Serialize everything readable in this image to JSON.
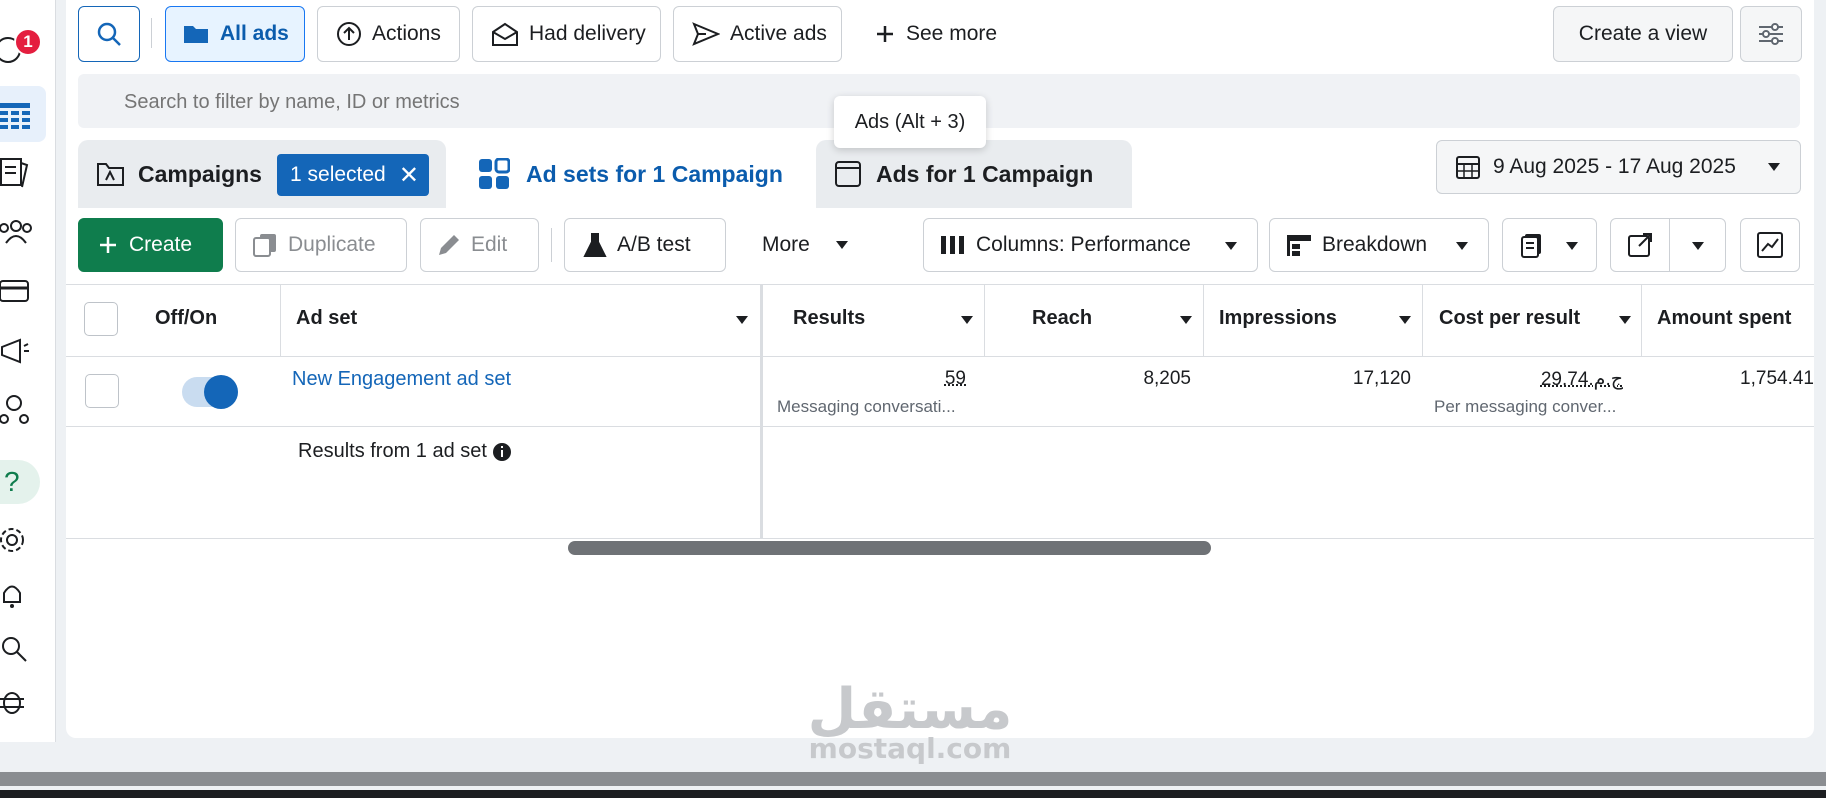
{
  "notifications": {
    "count": "1"
  },
  "filter_bar": {
    "chips": [
      {
        "label": "All ads"
      },
      {
        "label": "Actions"
      },
      {
        "label": "Had delivery"
      },
      {
        "label": "Active ads"
      }
    ],
    "see_more": "See more",
    "create_view": "Create a view"
  },
  "search": {
    "placeholder": "Search to filter by name, ID or metrics"
  },
  "tooltip": "Ads (Alt + 3)",
  "tabs": {
    "campaigns": {
      "label": "Campaigns",
      "selected_label": "1 selected"
    },
    "adsets": {
      "label": "Ad sets for 1 Campaign"
    },
    "ads": {
      "label": "Ads for 1 Campaign"
    }
  },
  "date_range": "9 Aug 2025 - 17 Aug 2025",
  "toolbar": {
    "create": "Create",
    "duplicate": "Duplicate",
    "edit": "Edit",
    "ab_test": "A/B test",
    "more": "More",
    "columns": "Columns: Performance",
    "breakdown": "Breakdown"
  },
  "table": {
    "headers": {
      "off_on": "Off/On",
      "ad_set": "Ad set",
      "results": "Results",
      "reach": "Reach",
      "impressions": "Impressions",
      "cost_per_result": "Cost per result",
      "amount_spent": "Amount spent"
    },
    "row": {
      "toggle_on": true,
      "name": "New Engagement ad set",
      "results": "59",
      "results_sub": "Messaging conversati...",
      "reach": "8,205",
      "impressions": "17,120",
      "cost_per_result": "ج.م.29.74",
      "cost_sub": "Per messaging conver...",
      "amount_spent": "1,754.41"
    },
    "summary": "Results from 1 ad set"
  },
  "watermark": {
    "arabic": "مستقل",
    "latin": "mostaql.com"
  },
  "colors": {
    "accent": "#1877f2",
    "create_green": "#0f7d4d",
    "link": "#1466b8"
  }
}
